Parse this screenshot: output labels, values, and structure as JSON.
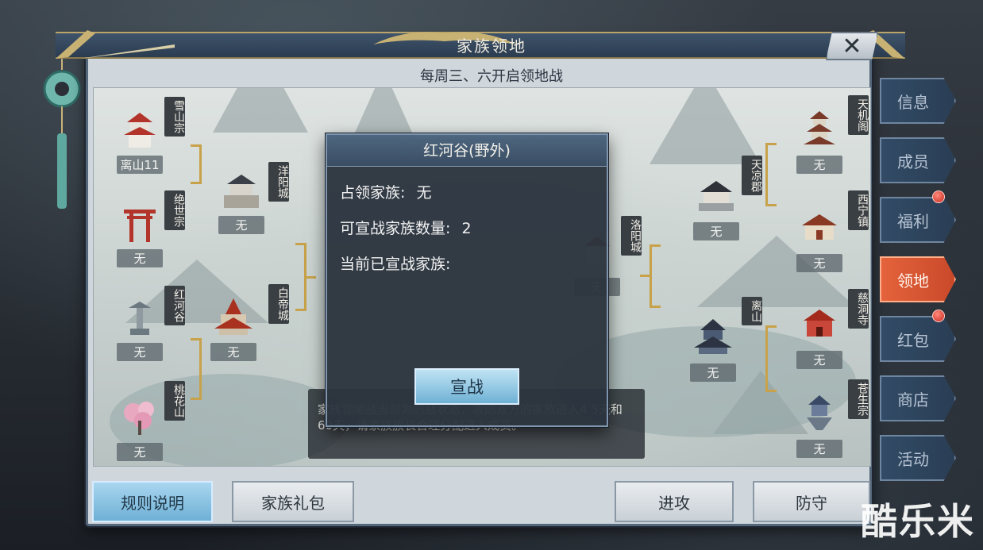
{
  "window": {
    "title": "家族领地",
    "subtitle": "每周三、六开启领地战",
    "close_label": "✕"
  },
  "map": {
    "left_nodes": [
      {
        "name": "雪山宗",
        "owner": "离山11"
      },
      {
        "name": "洋阳城",
        "owner": "无"
      },
      {
        "name": "绝世宗",
        "owner": "无"
      },
      {
        "name": "红河谷",
        "owner": "无"
      },
      {
        "name": "白帝城",
        "owner": "无"
      },
      {
        "name": "桃花山",
        "owner": "无"
      }
    ],
    "center_left_owners": [
      "无",
      "无"
    ],
    "center_right": {
      "name": "洛阳城",
      "owner": "无"
    },
    "right_nodes": [
      {
        "name": "天机阁",
        "owner": "无"
      },
      {
        "name": "天凉郡",
        "owner": "无"
      },
      {
        "name": "西宁镇",
        "owner": "无"
      },
      {
        "name": "慈洞寺",
        "owner": "无"
      },
      {
        "name": "离山",
        "owner": "无"
      },
      {
        "name": "苍生宗",
        "owner": "无"
      }
    ]
  },
  "popup": {
    "title": "红河谷(野外)",
    "occupy_label": "占领家族:",
    "occupy_value": "无",
    "declarable_label": "可宣战家族数量:",
    "declarable_value": "2",
    "declared_label": "当前已宣战家族:",
    "declare_button": "宣战"
  },
  "info_box": {
    "text": "家族领地战当前为防战状态，攻防双方的家族进入4 5天和60天，请家族族长合理分配进入成员。"
  },
  "bottom": {
    "rules_button": "规则说明",
    "gift_button": "家族礼包",
    "attack_button": "进攻",
    "defend_button": "防守"
  },
  "side_tabs": [
    {
      "label": "信息",
      "active": false,
      "badge": false
    },
    {
      "label": "成员",
      "active": false,
      "badge": false
    },
    {
      "label": "福利",
      "active": false,
      "badge": true
    },
    {
      "label": "领地",
      "active": true,
      "badge": false
    },
    {
      "label": "红包",
      "active": false,
      "badge": true
    },
    {
      "label": "商店",
      "active": false,
      "badge": false
    },
    {
      "label": "活动",
      "active": false,
      "badge": false
    }
  ],
  "watermark": "酷乐米",
  "colors": {
    "accent_gold": "#c8a24a",
    "active_tab": "#e4633c",
    "badge_red": "#c82820",
    "declare_button": "#6fb1d4"
  }
}
